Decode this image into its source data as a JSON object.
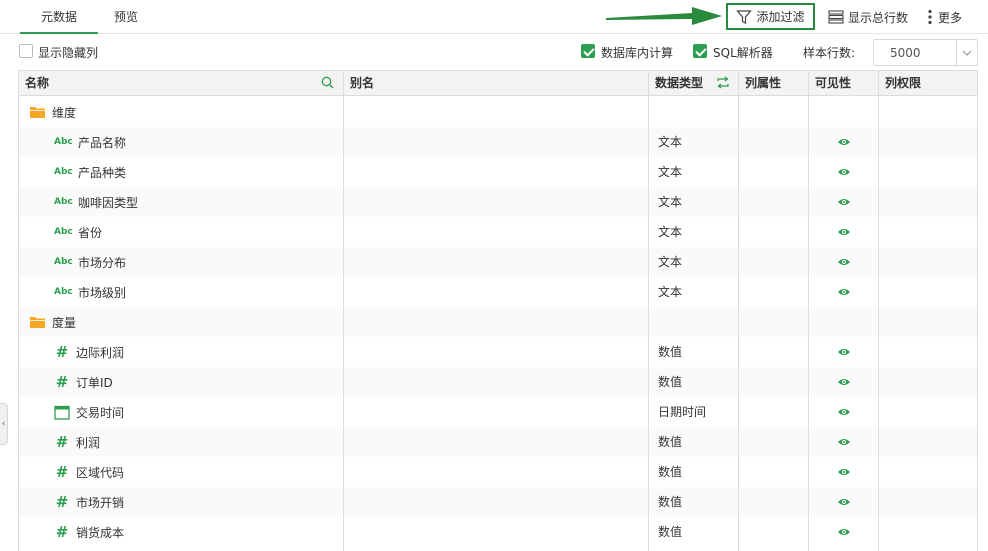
{
  "tabs": [
    {
      "label": "元数据",
      "active": true
    },
    {
      "label": "预览",
      "active": false
    }
  ],
  "toolbar": {
    "filter_label": "添加过滤",
    "total_rows_label": "显示总行数",
    "more_label": "更多"
  },
  "options": {
    "show_hidden_label": "显示隐藏列",
    "show_hidden_checked": false,
    "db_compute_label": "数据库内计算",
    "db_compute_checked": true,
    "sql_parser_label": "SQL解析器",
    "sql_parser_checked": true,
    "sample_rows_label": "样本行数:",
    "sample_rows_value": "5000"
  },
  "columns": {
    "name": "名称",
    "alias": "别名",
    "data_type": "数据类型",
    "column_attr": "列属性",
    "visibility": "可见性",
    "column_perm": "列权限"
  },
  "rows": [
    {
      "kind": "folder",
      "name": "维度",
      "type": ""
    },
    {
      "kind": "text",
      "name": "产品名称",
      "type": "文本",
      "visible": true
    },
    {
      "kind": "text",
      "name": "产品种类",
      "type": "文本",
      "visible": true
    },
    {
      "kind": "text",
      "name": "咖啡因类型",
      "type": "文本",
      "visible": true
    },
    {
      "kind": "text",
      "name": "省份",
      "type": "文本",
      "visible": true
    },
    {
      "kind": "text",
      "name": "市场分布",
      "type": "文本",
      "visible": true
    },
    {
      "kind": "text",
      "name": "市场级别",
      "type": "文本",
      "visible": true
    },
    {
      "kind": "folder",
      "name": "度量",
      "type": ""
    },
    {
      "kind": "number",
      "name": "边际利润",
      "type": "数值",
      "visible": true
    },
    {
      "kind": "number",
      "name": "订单ID",
      "type": "数值",
      "visible": true
    },
    {
      "kind": "date",
      "name": "交易时间",
      "type": "日期时间",
      "visible": true
    },
    {
      "kind": "number",
      "name": "利润",
      "type": "数值",
      "visible": true
    },
    {
      "kind": "number",
      "name": "区域代码",
      "type": "数值",
      "visible": true
    },
    {
      "kind": "number",
      "name": "市场开销",
      "type": "数值",
      "visible": true
    },
    {
      "kind": "number",
      "name": "销货成本",
      "type": "数值",
      "visible": true
    }
  ],
  "icons": {
    "text_type": "Abc",
    "number_type": "#",
    "side_handle": "‹"
  },
  "colors": {
    "accent": "#2d9e4f",
    "folder": "#f5a623",
    "highlight_border": "#2a8a3e"
  }
}
